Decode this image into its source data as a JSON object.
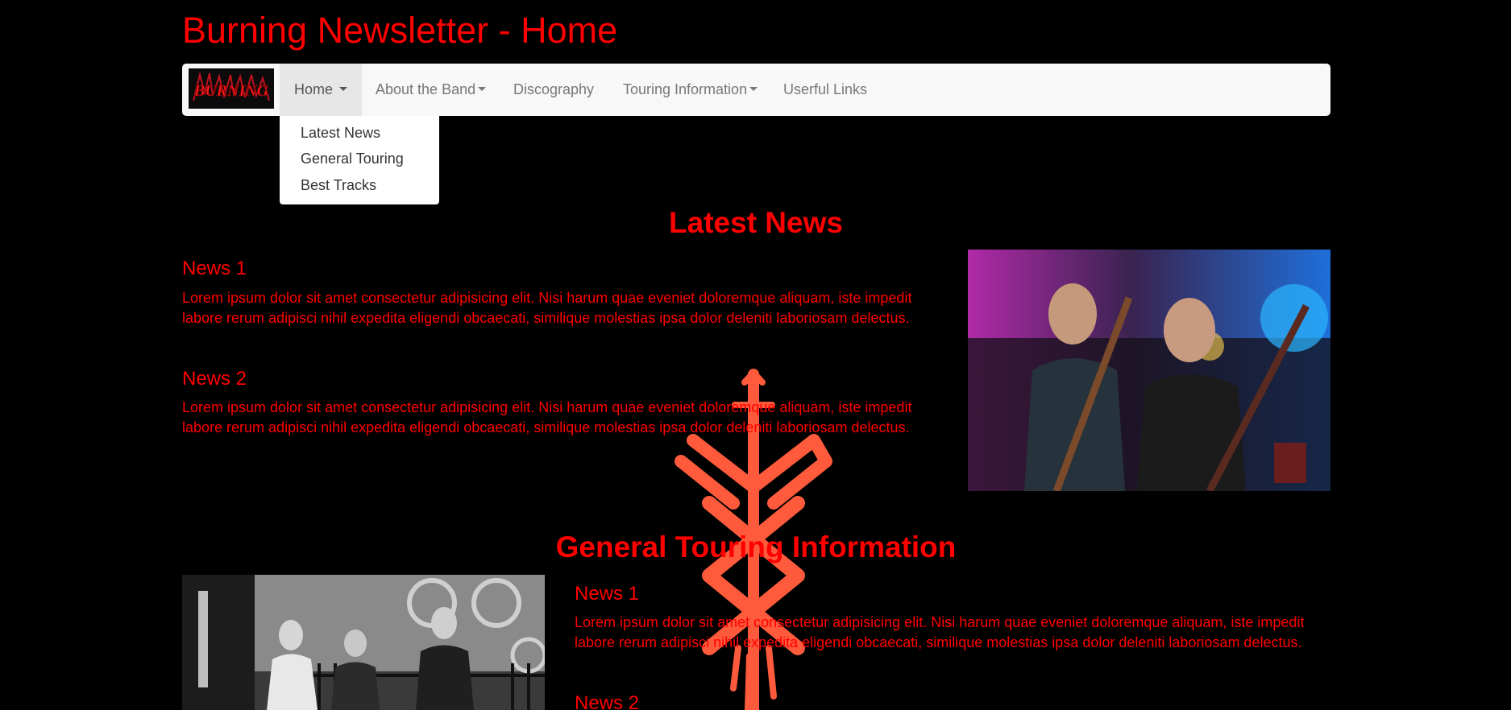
{
  "header": {
    "title": "Burning Newsletter - Home"
  },
  "navbar": {
    "brand_logo_text": "BURNING",
    "items": [
      {
        "label": "Home",
        "active": true,
        "has_caret": true
      },
      {
        "label": "About the Band",
        "active": false,
        "has_caret": true
      },
      {
        "label": "Discography",
        "active": false,
        "has_caret": false
      },
      {
        "label": "Touring Information",
        "active": false,
        "has_caret": true
      },
      {
        "label": "Userful Links",
        "active": false,
        "has_caret": false
      }
    ]
  },
  "dropdown": {
    "items": [
      "Latest News",
      "General Touring",
      "Best Tracks"
    ]
  },
  "latest_news": {
    "title": "Latest News",
    "items": [
      {
        "heading": "News 1",
        "body": "Lorem ipsum dolor sit amet consectetur adipisicing elit. Nisi harum quae eveniet doloremque aliquam, iste impedit labore rerum adipisci nihil expedita eligendi obcaecati, similique molestias ipsa dolor deleniti laboriosam delectus."
      },
      {
        "heading": "News 2",
        "body": "Lorem ipsum dolor sit amet consectetur adipisicing elit. Nisi harum quae eveniet doloremque aliquam, iste impedit labore rerum adipisci nihil expedita eligendi obcaecati, similique molestias ipsa dolor deleniti laboriosam delectus."
      }
    ]
  },
  "touring": {
    "title": "General Touring Information",
    "items": [
      {
        "heading": "News 1",
        "body": "Lorem ipsum dolor sit amet consectetur adipisicing elit. Nisi harum quae eveniet doloremque aliquam, iste impedit labore rerum adipisci nihil expedita eligendi obcaecati, similique molestias ipsa dolor deleniti laboriosam delectus."
      },
      {
        "heading": "News 2",
        "body": ""
      }
    ]
  },
  "colors": {
    "background": "#000000",
    "accent": "#ff0000",
    "navbar_bg": "#f8f8f8",
    "nav_active_bg": "#e7e7e7",
    "nav_text": "#777777",
    "emblem": "#ff5a3c"
  },
  "icons": {
    "emblem": "brand-of-sacrifice-icon",
    "caret": "caret-down-icon"
  }
}
